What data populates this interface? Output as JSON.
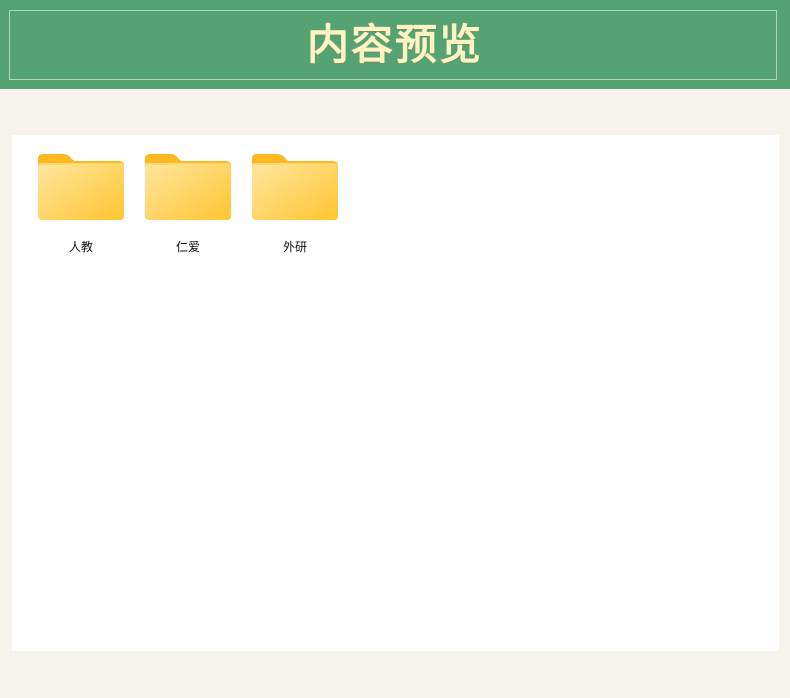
{
  "header": {
    "title": "内容预览"
  },
  "folders": [
    {
      "label": "人教",
      "icon": "folder-icon"
    },
    {
      "label": "仁爱",
      "icon": "folder-icon"
    },
    {
      "label": "外研",
      "icon": "folder-icon"
    }
  ],
  "colors": {
    "header_bg": "#55a373",
    "title_text": "#fff3c4",
    "page_bg": "#f6f3ec",
    "panel_bg": "#ffffff",
    "folder_yellow": "#ffc83d"
  }
}
